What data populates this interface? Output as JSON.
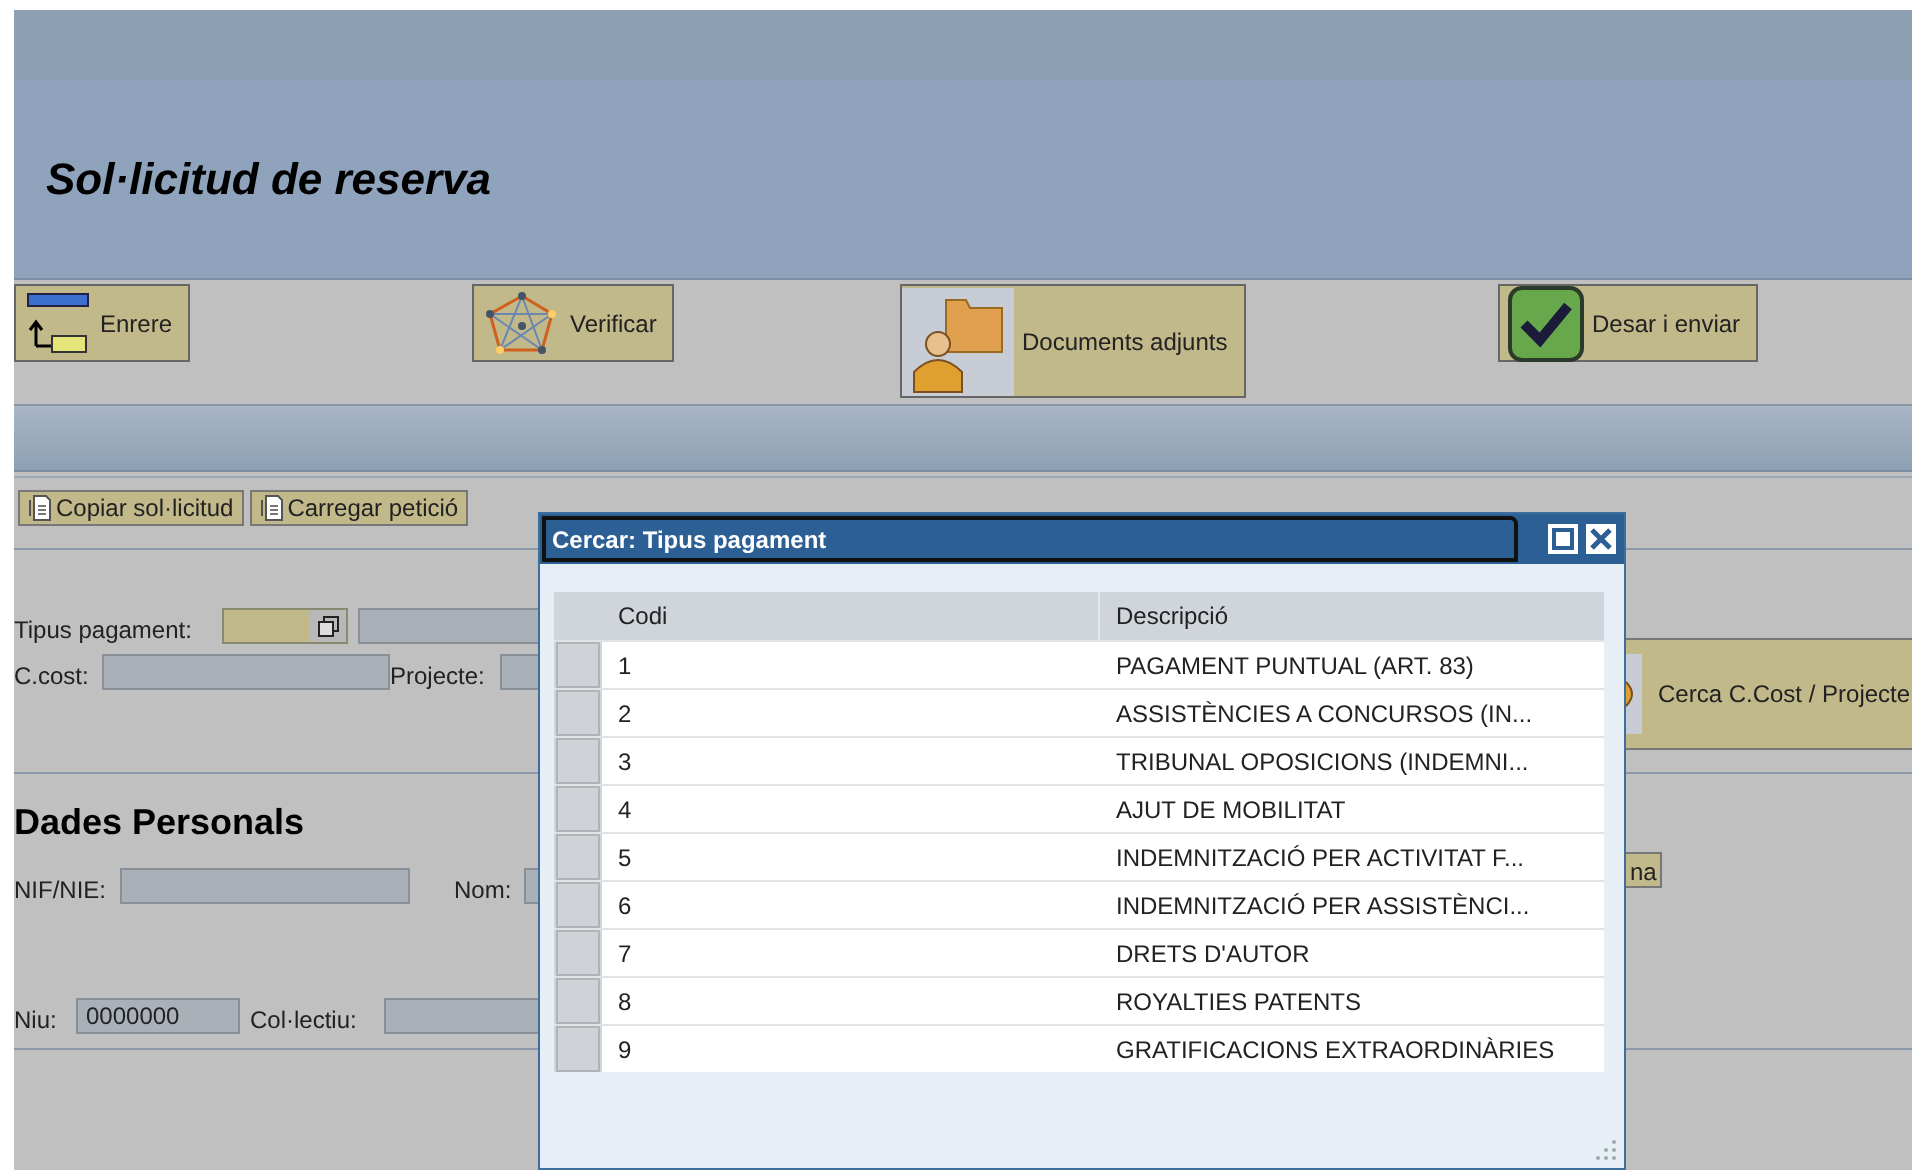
{
  "page_title": "Sol·licitud de reserva",
  "toolbar": [
    {
      "kind": "back",
      "label": "Enrere"
    },
    {
      "kind": "verify",
      "label": "Verificar"
    },
    {
      "kind": "documents",
      "label": "Documents adjunts"
    },
    {
      "kind": "save",
      "label": "Desar i enviar"
    }
  ],
  "actions": [
    "Copiar sol·licitud",
    "Carregar petició"
  ],
  "payment": {
    "label": "Tipus pagament:",
    "cost_center_label": "C.cost:",
    "project_label": "Projecte:",
    "search_button": "Cerca C.Cost / Projecte"
  },
  "personal": {
    "heading": "Dades Personals",
    "nif_label": "NIF/NIE:",
    "name_label": "Nom:",
    "button_fragment": "na",
    "niu_label": "Niu:",
    "niu_value": "0000000",
    "group_label": "Col·lectiu:"
  },
  "dialog": {
    "title": "Cercar: Tipus pagament",
    "columns": [
      "Codi",
      "Descripció"
    ],
    "rows": [
      {
        "code": "1",
        "description": "PAGAMENT PUNTUAL (ART. 83)"
      },
      {
        "code": "2",
        "description": "ASSISTÈNCIES A CONCURSOS (IN..."
      },
      {
        "code": "3",
        "description": "TRIBUNAL OPOSICIONS (INDEMNI..."
      },
      {
        "code": "4",
        "description": "AJUT DE MOBILITAT"
      },
      {
        "code": "5",
        "description": "INDEMNITZACIÓ PER ACTIVITAT F..."
      },
      {
        "code": "6",
        "description": "INDEMNITZACIÓ PER ASSISTÈNCI..."
      },
      {
        "code": "7",
        "description": "DRETS D'AUTOR"
      },
      {
        "code": "8",
        "description": "ROYALTIES PATENTS"
      },
      {
        "code": "9",
        "description": "GRATIFICACIONS EXTRAORDINÀRIES"
      }
    ]
  }
}
